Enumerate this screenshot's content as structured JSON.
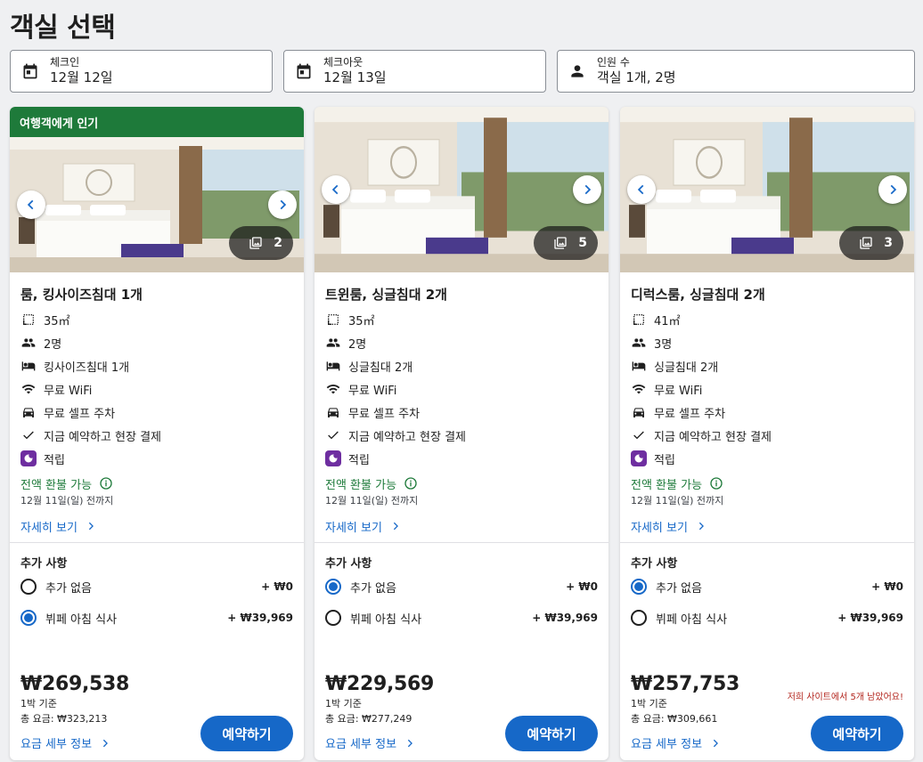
{
  "page": {
    "title": "객실 선택"
  },
  "search": {
    "checkin": {
      "label": "체크인",
      "value": "12월 12일",
      "icon": "calendar-icon"
    },
    "checkout": {
      "label": "체크아웃",
      "value": "12월 13일",
      "icon": "calendar-icon"
    },
    "guests": {
      "label": "인원 수",
      "value": "객실 1개, 2명",
      "icon": "person-icon"
    }
  },
  "colors": {
    "accent": "#1668c8",
    "popular": "#1e7a3a",
    "rewards": "#6e2ea0",
    "warning": "#b3261e"
  },
  "rooms": [
    {
      "badge": "여행객에게 인기",
      "photo_count": "2",
      "name": "룸, 킹사이즈침대 1개",
      "size": "35㎡",
      "occupancy": "2명",
      "bed": "킹사이즈침대 1개",
      "wifi": "무료 WiFi",
      "parking": "무료 셀프 주차",
      "pay": "지금 예약하고 현장 결제",
      "rewards": "적립",
      "refund": "전액 환불 가능",
      "refund_date": "12월 11일(일) 전까지",
      "details": "자세히 보기",
      "extras_title": "추가 사항",
      "option1": {
        "label": "추가 없음",
        "price": "+ ₩0",
        "selected": false
      },
      "option2": {
        "label": "뷔페 아침 식사",
        "price": "+ ₩39,969",
        "selected": true
      },
      "price": "₩269,538",
      "per_night": "1박 기준",
      "total": "총 요금: ₩323,213",
      "price_details": "요금 세부 정보",
      "reserve": "예약하기",
      "scarcity": ""
    },
    {
      "badge": "",
      "photo_count": "5",
      "name": "트윈룸, 싱글침대 2개",
      "size": "35㎡",
      "occupancy": "2명",
      "bed": "싱글침대 2개",
      "wifi": "무료 WiFi",
      "parking": "무료 셀프 주차",
      "pay": "지금 예약하고 현장 결제",
      "rewards": "적립",
      "refund": "전액 환불 가능",
      "refund_date": "12월 11일(일) 전까지",
      "details": "자세히 보기",
      "extras_title": "추가 사항",
      "option1": {
        "label": "추가 없음",
        "price": "+ ₩0",
        "selected": true
      },
      "option2": {
        "label": "뷔페 아침 식사",
        "price": "+ ₩39,969",
        "selected": false
      },
      "price": "₩229,569",
      "per_night": "1박 기준",
      "total": "총 요금: ₩277,249",
      "price_details": "요금 세부 정보",
      "reserve": "예약하기",
      "scarcity": ""
    },
    {
      "badge": "",
      "photo_count": "3",
      "name": "디럭스룸, 싱글침대 2개",
      "size": "41㎡",
      "occupancy": "3명",
      "bed": "싱글침대 2개",
      "wifi": "무료 WiFi",
      "parking": "무료 셀프 주차",
      "pay": "지금 예약하고 현장 결제",
      "rewards": "적립",
      "refund": "전액 환불 가능",
      "refund_date": "12월 11일(일) 전까지",
      "details": "자세히 보기",
      "extras_title": "추가 사항",
      "option1": {
        "label": "추가 없음",
        "price": "+ ₩0",
        "selected": true
      },
      "option2": {
        "label": "뷔페 아침 식사",
        "price": "+ ₩39,969",
        "selected": false
      },
      "price": "₩257,753",
      "per_night": "1박 기준",
      "total": "총 요금: ₩309,661",
      "price_details": "요금 세부 정보",
      "reserve": "예약하기",
      "scarcity": "저희 사이트에서 5개 남았어요!"
    }
  ]
}
